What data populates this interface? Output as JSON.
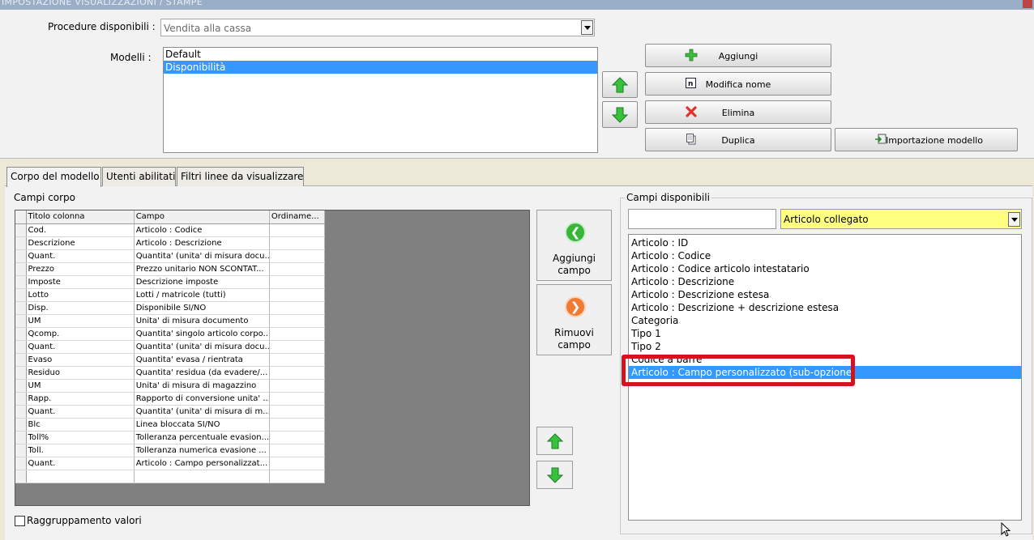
{
  "window": {
    "title": "IMPOSTAZIONE VISUALIZZAZIONI / STAMPE"
  },
  "procedure": {
    "label": "Procedure disponibili :",
    "value": "Vendita alla cassa"
  },
  "modelli": {
    "label": "Modelli :",
    "items": [
      "Default",
      "Disponibilità"
    ],
    "selected_index": 1
  },
  "buttons": {
    "aggiungi": "Aggiungi",
    "modifica_nome": "Modifica nome",
    "elimina": "Elimina",
    "duplica": "Duplica",
    "importazione": "Importazione modello",
    "aggiungi_campo_1": "Aggiungi",
    "aggiungi_campo_2": "campo",
    "rimuovi_campo_1": "Rimuovi",
    "rimuovi_campo_2": "campo"
  },
  "tabs": [
    "Corpo del modello",
    "Utenti abilitati",
    "Filtri linee da visualizzare"
  ],
  "campi_corpo": {
    "label": "Campi corpo",
    "headers": [
      "Titolo colonna",
      "Campo",
      "Ordiname..."
    ],
    "rows": [
      [
        "Cod.",
        "Articolo : Codice",
        ""
      ],
      [
        "Descrizione",
        "Articolo : Descrizione",
        ""
      ],
      [
        "Quant.",
        "Quantita' (unita' di misura docu...",
        ""
      ],
      [
        "Prezzo",
        "Prezzo unitario NON SCONTAT...",
        ""
      ],
      [
        "Imposte",
        "Descrizione imposte",
        ""
      ],
      [
        "Lotto",
        "Lotti / matricole (tutti)",
        ""
      ],
      [
        "Disp.",
        "Disponibile SI/NO",
        ""
      ],
      [
        "UM",
        "Unita' di misura documento",
        ""
      ],
      [
        "Qcomp.",
        "Quantita' singolo articolo corpo...",
        ""
      ],
      [
        "Quant.",
        "Quantita' (unita' di misura docu...",
        ""
      ],
      [
        "Evaso",
        "Quantita' evasa / rientrata",
        ""
      ],
      [
        "Residuo",
        "Quantita' residua (da evadere/...",
        ""
      ],
      [
        "UM",
        "Unita' di misura di magazzino",
        ""
      ],
      [
        "Rapp.",
        "Rapporto di conversione unita' ...",
        ""
      ],
      [
        "Quant.",
        "Quantita' (unita' di misura di m...",
        ""
      ],
      [
        "Blc",
        "Linea bloccata SI/NO",
        ""
      ],
      [
        "Toll%",
        "Tolleranza percentuale evasion...",
        ""
      ],
      [
        "Toll.",
        "Tolleranza numerica evasione ...",
        ""
      ],
      [
        "Quant.",
        "Articolo : Campo personalizzat...",
        ""
      ],
      [
        "",
        "",
        ""
      ]
    ]
  },
  "raggruppamento": {
    "label": "Raggruppamento valori"
  },
  "campi_disponibili": {
    "label": "Campi disponibili",
    "search_value": "",
    "category_value": "Articolo collegato",
    "items": [
      "Articolo : ID",
      "Articolo : Codice",
      "Articolo : Codice articolo intestatario",
      "Articolo : Descrizione",
      "Articolo : Descrizione estesa",
      "Articolo : Descrizione + descrizione estesa",
      "Categoria",
      "Tipo 1",
      "Tipo 2",
      "Codice a barre",
      "Articolo : Campo personalizzato (sub-opzione)"
    ],
    "selected_index": 10
  },
  "colors": {
    "selection": "#3399ff",
    "highlight": "#d2141e",
    "category_bg": "#ffff80"
  }
}
